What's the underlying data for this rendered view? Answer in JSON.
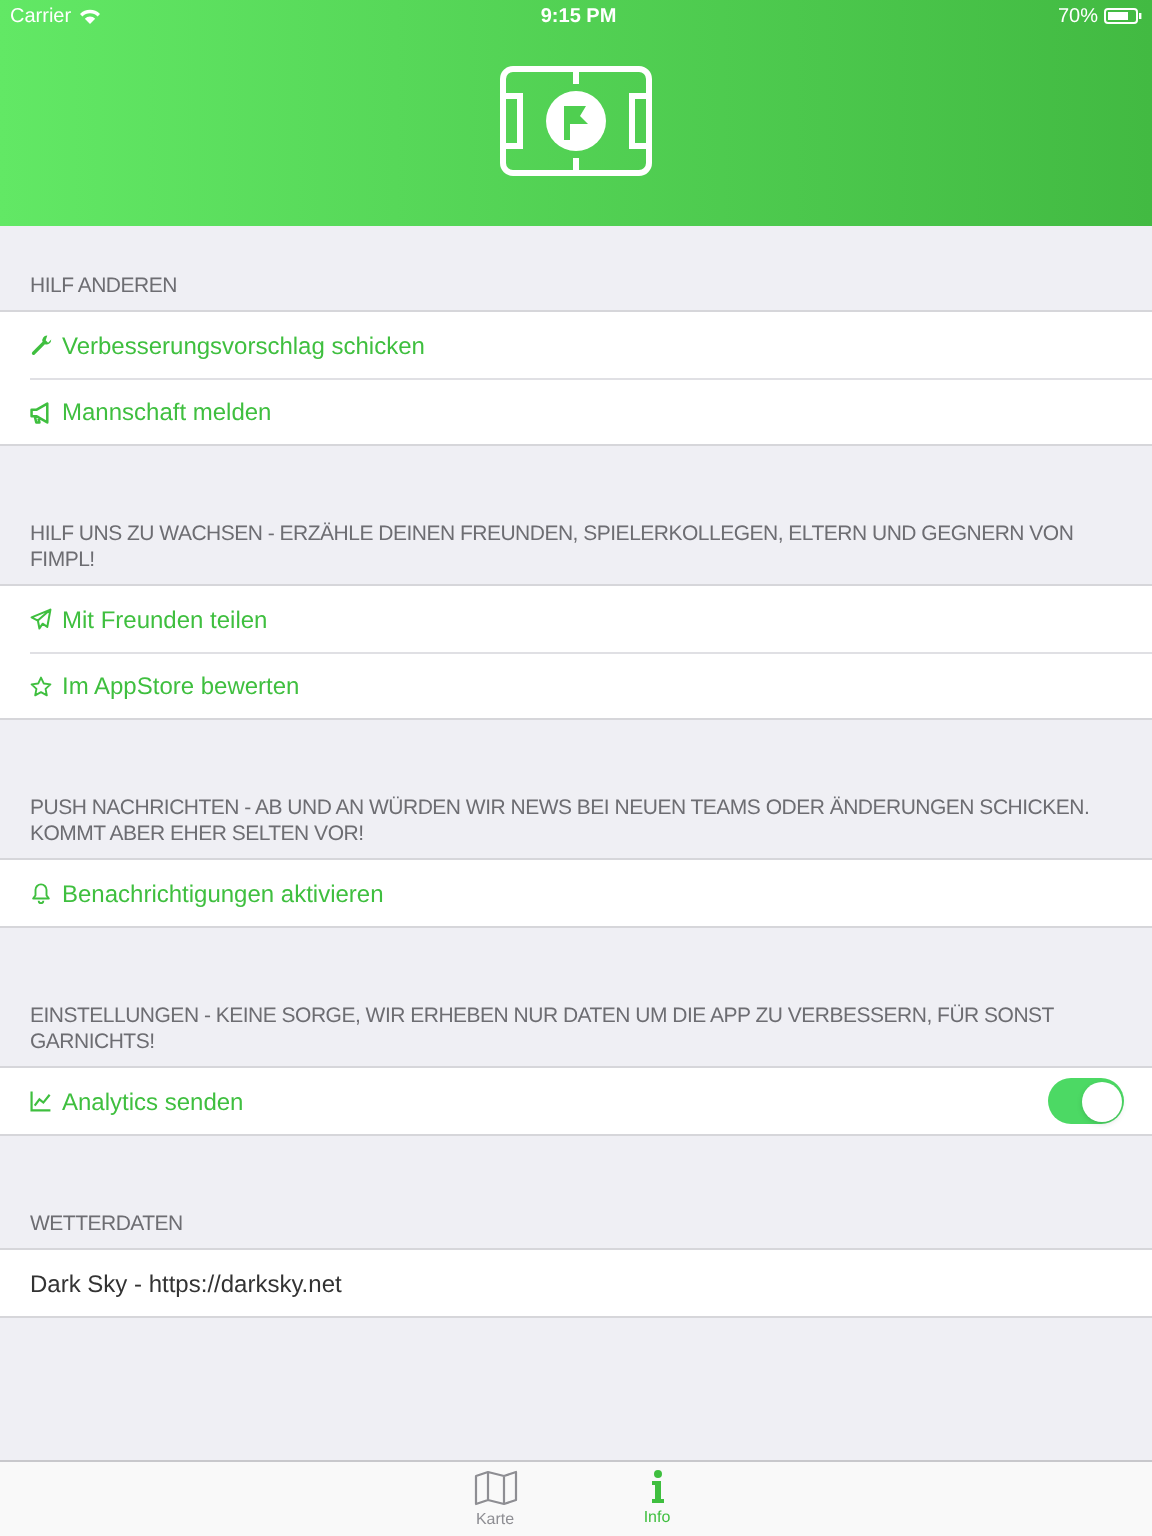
{
  "status_bar": {
    "carrier": "Carrier",
    "time": "9:15 PM",
    "battery": "70%"
  },
  "sections": [
    {
      "header": "HILF ANDEREN",
      "rows": [
        {
          "kind": "action",
          "label": "Verbesserungsvorschlag schicken"
        },
        {
          "kind": "action",
          "label": "Mannschaft melden"
        }
      ]
    },
    {
      "header": "HILF UNS ZU WACHSEN - ERZÄHLE DEINEN FREUNDEN, SPIELERKOLLEGEN, ELTERN UND GEGNERN VON FIMPL!",
      "rows": [
        {
          "kind": "action",
          "label": "Mit Freunden teilen"
        },
        {
          "kind": "action",
          "label": "Im AppStore bewerten"
        }
      ]
    },
    {
      "header": "PUSH NACHRICHTEN - AB UND AN WÜRDEN WIR NEWS BEI NEUEN TEAMS ODER ÄNDERUNGEN SCHICKEN. KOMMT ABER EHER SELTEN VOR!",
      "rows": [
        {
          "kind": "action",
          "label": "Benachrichtigungen aktivieren"
        }
      ]
    },
    {
      "header": "EINSTELLUNGEN - KEINE SORGE, WIR ERHEBEN NUR DATEN UM DIE APP ZU VERBESSERN, FÜR SONST GARNICHTS!",
      "rows": [
        {
          "kind": "toggle",
          "label": "Analytics senden",
          "on": true
        }
      ]
    },
    {
      "header": "WETTERDATEN",
      "rows": [
        {
          "kind": "text",
          "label": "Dark Sky - https://darksky.net"
        }
      ]
    }
  ],
  "tabs": [
    {
      "label": "Karte",
      "selected": false
    },
    {
      "label": "Info",
      "selected": true
    }
  ]
}
